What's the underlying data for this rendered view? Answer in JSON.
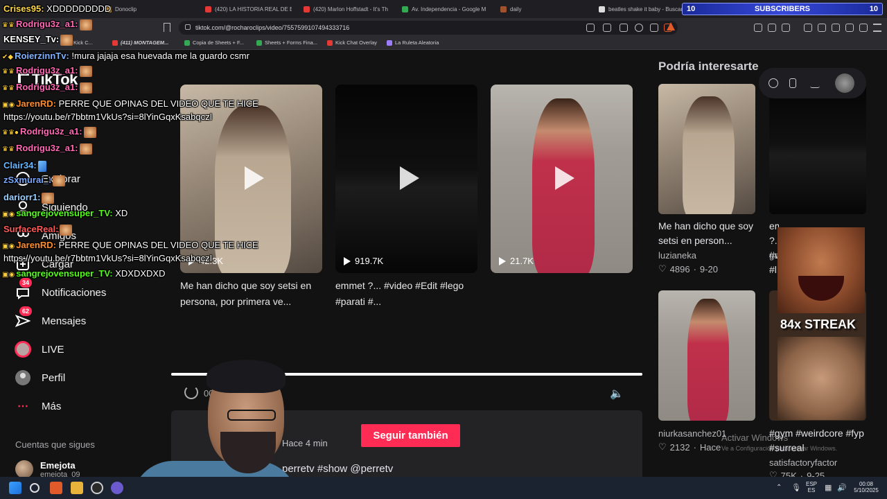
{
  "browser": {
    "tabs": [
      {
        "label": "Donoclip",
        "color": "#e0a23a"
      },
      {
        "label": "(420) LA HISTORIA REAL DE ES",
        "color": "#e53935"
      },
      {
        "label": "(420) Marlon Hoffstadt - It's Th",
        "color": "#e53935"
      },
      {
        "label": "Av. Independencia - Google M",
        "color": "#34a853"
      },
      {
        "label": "daily",
        "color": "#a0522d"
      },
      {
        "label": "beatles shake it baby - Buscar",
        "color": "#dddddd"
      }
    ],
    "subscribers": {
      "left": "10",
      "label": "SUBSCRIBERS",
      "right": "10"
    },
    "url": "tiktok.com/@rocharoclips/video/7557599107494333716",
    "bookmarks": [
      {
        "label": "Kick C...",
        "color": "#53fc18"
      },
      {
        "label": "(411) MONTAGEM...",
        "color": "#e53935"
      },
      {
        "label": "Copia de Sheets + F...",
        "color": "#34a853"
      },
      {
        "label": "Sheets + Forms Fina...",
        "color": "#34a853"
      },
      {
        "label": "Kick Chat Overlay",
        "color": "#e53935"
      },
      {
        "label": "La Ruleta Aleatoria",
        "color": "#9c7cff"
      }
    ]
  },
  "tiktok": {
    "logo": "TikTok",
    "nav": [
      {
        "label": "Explorar",
        "icon": "compass-icon"
      },
      {
        "label": "Siguiendo",
        "icon": "following-icon"
      },
      {
        "label": "Amigos",
        "icon": "friends-icon"
      },
      {
        "label": "Cargar",
        "icon": "upload-icon"
      },
      {
        "label": "Notificaciones",
        "icon": "inbox-icon",
        "badge": "34"
      },
      {
        "label": "Mensajes",
        "icon": "message-icon",
        "badge": "62"
      },
      {
        "label": "LIVE",
        "icon": "live-icon"
      },
      {
        "label": "Perfil",
        "icon": "profile-icon"
      },
      {
        "label": "Más",
        "icon": "more-icon"
      }
    ],
    "following_heading": "Cuentas que sigues",
    "followed_account": {
      "name": "Emejota",
      "handle": "emejota_09"
    },
    "videos": [
      {
        "views": "42.3K",
        "caption": "Me han dicho que soy setsi en persona, por primera ve..."
      },
      {
        "views": "919.7K",
        "caption": "emmet ?... #video #Edit #lego #parati #..."
      },
      {
        "views": "21.7K",
        "caption": ""
      }
    ],
    "player": {
      "progress": 1.0,
      "time": "00",
      "author": "s",
      "posted": "· Hace 4 min",
      "follow_label": "Seguir también",
      "tags": "perretv #show @perretv"
    },
    "suggestions": {
      "title": "Podría interesarte",
      "items": [
        {
          "caption": "Me han dicho que soy setsi en person...",
          "user": "luzianeka",
          "likes": "4896",
          "date": "9-20"
        },
        {
          "caption": "emmet ?... #video #l",
          "user": "ga",
          "likes": "",
          "date": ""
        },
        {
          "caption": "",
          "user": "niurkasanchez01",
          "likes": "2132",
          "date": "Hace"
        },
        {
          "caption": "#gym #weirdcore #fyp #surreal",
          "user": "satisfactoryfactor",
          "likes": "75K",
          "date": "9-25"
        }
      ]
    },
    "windows_watermark": {
      "title": "Activar Windows",
      "sub": "Ve a Configuración para activar Windows."
    }
  },
  "stream": {
    "chat": [
      {
        "badges": "",
        "name": "Crises95:",
        "name_color": "#ffd84a",
        "msg": " XDDDDDDDDD",
        "emote": ""
      },
      {
        "badges": "♛♛",
        "name": "Rodrigu3z_a1:",
        "name_color": "#ff69b4",
        "msg": "",
        "emote": "face"
      },
      {
        "badges": "",
        "name": "KENSEY_Tv:",
        "name_color": "#ffffff",
        "msg": "",
        "emote": "face"
      },
      {
        "badges": "✔◆",
        "name": "RoierzinnTv:",
        "name_color": "#7fb2ff",
        "msg": " !mura jajaja esa huevada me la guardo csmr",
        "emote": ""
      },
      {
        "badges": "♛♛",
        "name": "Rodrigu3z_a1:",
        "name_color": "#ff69b4",
        "msg": "",
        "emote": "face"
      },
      {
        "badges": "♛♛",
        "name": "Rodrigu3z_a1:",
        "name_color": "#ff69b4",
        "msg": "",
        "emote": "face"
      },
      {
        "badges": "▣◉",
        "name": "JarenRD:",
        "name_color": "#ff8c2a",
        "msg": " PERRE QUE OPINAS DEL VIDEO QUE TE HICE",
        "emote": ""
      },
      {
        "badges": "",
        "name": "",
        "name_color": "#ffffff",
        "msg": "https://youtu.be/r7bbtm1VkUs?si=8lYinGqxKsabqczI",
        "emote": ""
      },
      {
        "badges": "♛♛●",
        "name": "Rodrigu3z_a1:",
        "name_color": "#ff69b4",
        "msg": "",
        "emote": "face"
      },
      {
        "badges": "♛♛",
        "name": "Rodrigu3z_a1:",
        "name_color": "#ff69b4",
        "msg": "",
        "emote": "face"
      },
      {
        "badges": "",
        "name": "Clair34:",
        "name_color": "#6ab7ff",
        "msg": "",
        "emote": "blue"
      },
      {
        "badges": "",
        "name": "zSxmurai_:",
        "name_color": "#7aa8ff",
        "msg": "",
        "emote": "face"
      },
      {
        "badges": "",
        "name": "dariorr1:",
        "name_color": "#9ad0ff",
        "msg": "",
        "emote": "face"
      },
      {
        "badges": "▣◉",
        "name": "sangrejovensuper_TV:",
        "name_color": "#53fc18",
        "msg": " XD",
        "emote": ""
      },
      {
        "badges": "",
        "name": "SurfaceReal:",
        "name_color": "#ff5a5a",
        "msg": "",
        "emote": "face"
      },
      {
        "badges": "▣◉",
        "name": "JarenRD:",
        "name_color": "#ff8c2a",
        "msg": " PERRE QUE OPINAS DEL VIDEO QUE TE HICE",
        "emote": ""
      },
      {
        "badges": "",
        "name": "",
        "name_color": "#ffffff",
        "msg": "https://youtu.be/r7bbtm1VkUs?si=8lYinGqxKsabqczI",
        "emote": ""
      },
      {
        "badges": "▣◉",
        "name": "sangrejovensuper_TV:",
        "name_color": "#53fc18",
        "msg": " XDXDXDXD",
        "emote": ""
      }
    ],
    "streak": "84x STREAK"
  },
  "taskbar": {
    "lang_top": "ESP",
    "lang_bottom": "ES",
    "time": "00:08",
    "date": "5/10/2025"
  }
}
